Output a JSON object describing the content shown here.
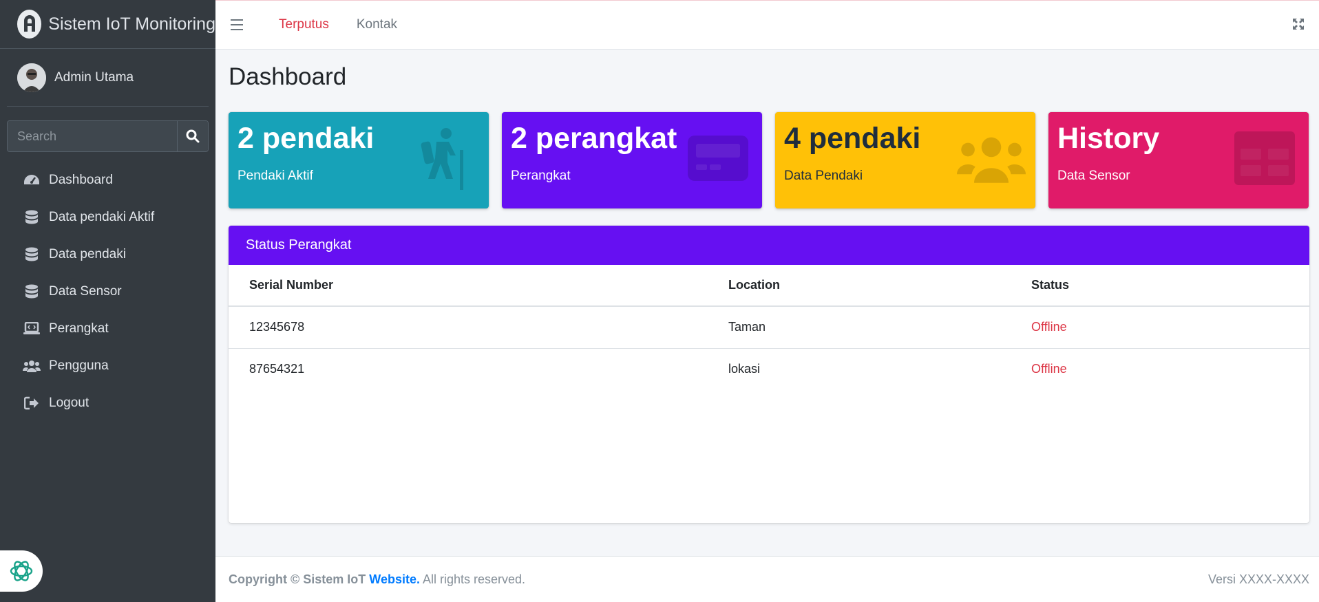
{
  "brand": {
    "title": "Sistem IoT Monitoring"
  },
  "user": {
    "name": "Admin Utama"
  },
  "search": {
    "placeholder": "Search"
  },
  "sidebar": {
    "items": [
      {
        "label": "Dashboard",
        "icon": "tachometer-icon"
      },
      {
        "label": "Data pendaki Aktif",
        "icon": "database-icon"
      },
      {
        "label": "Data pendaki",
        "icon": "database-icon"
      },
      {
        "label": "Data Sensor",
        "icon": "database-icon"
      },
      {
        "label": "Perangkat",
        "icon": "laptop-code-icon"
      },
      {
        "label": "Pengguna",
        "icon": "users-icon"
      },
      {
        "label": "Logout",
        "icon": "sign-out-icon"
      }
    ]
  },
  "topbar": {
    "status_link": "Terputus",
    "contact_link": "Kontak",
    "status_color": "#dc3545"
  },
  "page": {
    "title": "Dashboard"
  },
  "boxes": [
    {
      "value": "2 pendaki",
      "label": "Pendaki Aktif",
      "color": "#17a2b8",
      "icon": "hiking-icon"
    },
    {
      "value": "2 perangkat",
      "label": "Perangkat",
      "color": "#6610f2",
      "icon": "device-card-icon"
    },
    {
      "value": "4 pendaki",
      "label": "Data Pendaki",
      "color": "#ffc107",
      "icon": "users-icon"
    },
    {
      "value": "History",
      "label": "Data Sensor",
      "color": "#e01b69",
      "icon": "table-icon"
    }
  ],
  "status_card": {
    "title": "Status Perangkat",
    "columns": [
      "Serial Number",
      "Location",
      "Status"
    ],
    "rows": [
      {
        "serial": "12345678",
        "location": "Taman",
        "status": "Offline"
      },
      {
        "serial": "87654321",
        "location": "lokasi",
        "status": "Offline"
      }
    ]
  },
  "footer": {
    "copyright_prefix": "Copyright © Sistem IoT ",
    "link_text": "Website.",
    "rights": " All rights reserved.",
    "version": "Versi XXXX-XXXX"
  }
}
